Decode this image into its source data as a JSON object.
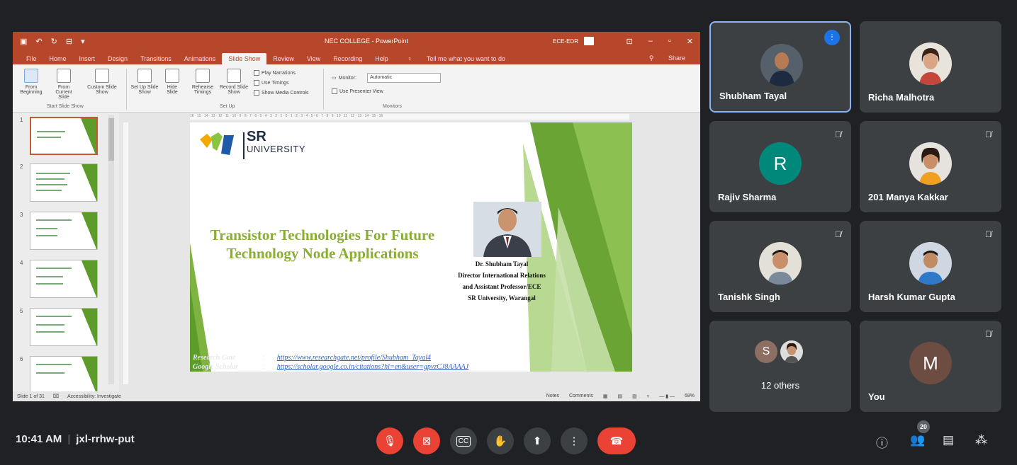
{
  "app": {
    "window_title": "NEC COLLEGE - PowerPoint",
    "account": "ECE-EDR",
    "share": "Share",
    "menu": [
      "File",
      "Home",
      "Insert",
      "Design",
      "Transitions",
      "Animations",
      "Slide Show",
      "Review",
      "View",
      "Recording",
      "Help"
    ],
    "tell_me": "Tell me what you want to do",
    "ribbon": {
      "from_beginning": "From Beginning",
      "from_current": "From Current Slide",
      "custom_show": "Custom Slide Show",
      "group_start": "Start Slide Show",
      "setup_show": "Set Up Slide Show",
      "hide_slide": "Hide Slide",
      "rehearse": "Rehearse Timings",
      "record": "Record Slide Show",
      "play_narrations": "Play Narrations",
      "use_timings": "Use Timings",
      "show_media": "Show Media Controls",
      "group_setup": "Set Up",
      "monitor_label": "Monitor:",
      "monitor_value": "Automatic",
      "presenter_view": "Use Presenter View",
      "group_monitors": "Monitors"
    },
    "ruler_text": "16 · 15 · 14 · 13 · 12 · 11 · 10 · 9 · 8 · 7 · 6 · 5 · 4 · 3 · 2 · 1 · 0 · 1 · 2 · 3 · 4 · 5 · 6 · 7 · 8 · 9 · 10 · 11 · 12 · 13 · 14 · 15 · 16",
    "thumb_numbers": [
      "1",
      "2",
      "3",
      "4",
      "5",
      "6"
    ],
    "status": {
      "slide_of": "Slide 1 of 31",
      "accessibility": "Accessibility: Investigate",
      "notes": "Notes",
      "comments": "Comments",
      "zoom": "68%"
    }
  },
  "slide": {
    "logo_sr": "SR",
    "logo_university": "UNIVERSITY",
    "title_line1": "Transistor Technologies For Future",
    "title_line2": "Technology Node Applications",
    "presenter_name": "Dr. Shubham Tayal",
    "presenter_role1": "Director International Relations",
    "presenter_role2": "and Assistant Professor/ECE",
    "presenter_org": "SR University, Warangal",
    "research_gate_label": "Research Gate",
    "research_gate_url": "https://www.researchgate.net/profile/Shubham_Tayal4",
    "scholar_label": "Google Scholar",
    "scholar_url": "https://scholar.google.co.in/citations?hl=en&user=gpvzCJ8AAAAJ",
    "colon": ":"
  },
  "participants": [
    {
      "name": "Shubham Tayal",
      "speaking": true
    },
    {
      "name": "Richa Malhotra"
    },
    {
      "name": "Rajiv Sharma",
      "initial": "R",
      "color": "#00897b"
    },
    {
      "name": "201 Manya Kakkar"
    },
    {
      "name": "Tanishk Singh"
    },
    {
      "name": "Harsh Kumar Gupta"
    },
    {
      "name": "12 others",
      "initial": "S",
      "color": "#8d6e63"
    },
    {
      "name": "You",
      "initial": "M",
      "color": "#6d4c41"
    }
  ],
  "meeting": {
    "time": "10:41 AM",
    "separator": "|",
    "code": "jxl-rrhw-put",
    "participant_count": "20"
  },
  "colors": {
    "background": "#202124",
    "tile": "#3c4043",
    "red": "#ea4335",
    "ppt": "#b7472a",
    "slide_title": "#8aae34"
  }
}
